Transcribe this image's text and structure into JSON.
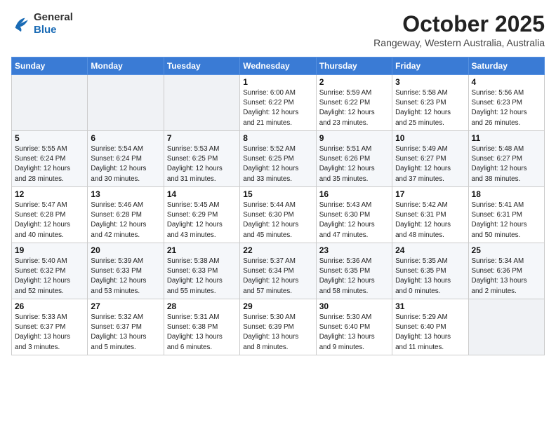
{
  "header": {
    "logo_line1": "General",
    "logo_line2": "Blue",
    "month_year": "October 2025",
    "location": "Rangeway, Western Australia, Australia"
  },
  "weekdays": [
    "Sunday",
    "Monday",
    "Tuesday",
    "Wednesday",
    "Thursday",
    "Friday",
    "Saturday"
  ],
  "weeks": [
    [
      {
        "day": "",
        "info": ""
      },
      {
        "day": "",
        "info": ""
      },
      {
        "day": "",
        "info": ""
      },
      {
        "day": "1",
        "info": "Sunrise: 6:00 AM\nSunset: 6:22 PM\nDaylight: 12 hours\nand 21 minutes."
      },
      {
        "day": "2",
        "info": "Sunrise: 5:59 AM\nSunset: 6:22 PM\nDaylight: 12 hours\nand 23 minutes."
      },
      {
        "day": "3",
        "info": "Sunrise: 5:58 AM\nSunset: 6:23 PM\nDaylight: 12 hours\nand 25 minutes."
      },
      {
        "day": "4",
        "info": "Sunrise: 5:56 AM\nSunset: 6:23 PM\nDaylight: 12 hours\nand 26 minutes."
      }
    ],
    [
      {
        "day": "5",
        "info": "Sunrise: 5:55 AM\nSunset: 6:24 PM\nDaylight: 12 hours\nand 28 minutes."
      },
      {
        "day": "6",
        "info": "Sunrise: 5:54 AM\nSunset: 6:24 PM\nDaylight: 12 hours\nand 30 minutes."
      },
      {
        "day": "7",
        "info": "Sunrise: 5:53 AM\nSunset: 6:25 PM\nDaylight: 12 hours\nand 31 minutes."
      },
      {
        "day": "8",
        "info": "Sunrise: 5:52 AM\nSunset: 6:25 PM\nDaylight: 12 hours\nand 33 minutes."
      },
      {
        "day": "9",
        "info": "Sunrise: 5:51 AM\nSunset: 6:26 PM\nDaylight: 12 hours\nand 35 minutes."
      },
      {
        "day": "10",
        "info": "Sunrise: 5:49 AM\nSunset: 6:27 PM\nDaylight: 12 hours\nand 37 minutes."
      },
      {
        "day": "11",
        "info": "Sunrise: 5:48 AM\nSunset: 6:27 PM\nDaylight: 12 hours\nand 38 minutes."
      }
    ],
    [
      {
        "day": "12",
        "info": "Sunrise: 5:47 AM\nSunset: 6:28 PM\nDaylight: 12 hours\nand 40 minutes."
      },
      {
        "day": "13",
        "info": "Sunrise: 5:46 AM\nSunset: 6:28 PM\nDaylight: 12 hours\nand 42 minutes."
      },
      {
        "day": "14",
        "info": "Sunrise: 5:45 AM\nSunset: 6:29 PM\nDaylight: 12 hours\nand 43 minutes."
      },
      {
        "day": "15",
        "info": "Sunrise: 5:44 AM\nSunset: 6:30 PM\nDaylight: 12 hours\nand 45 minutes."
      },
      {
        "day": "16",
        "info": "Sunrise: 5:43 AM\nSunset: 6:30 PM\nDaylight: 12 hours\nand 47 minutes."
      },
      {
        "day": "17",
        "info": "Sunrise: 5:42 AM\nSunset: 6:31 PM\nDaylight: 12 hours\nand 48 minutes."
      },
      {
        "day": "18",
        "info": "Sunrise: 5:41 AM\nSunset: 6:31 PM\nDaylight: 12 hours\nand 50 minutes."
      }
    ],
    [
      {
        "day": "19",
        "info": "Sunrise: 5:40 AM\nSunset: 6:32 PM\nDaylight: 12 hours\nand 52 minutes."
      },
      {
        "day": "20",
        "info": "Sunrise: 5:39 AM\nSunset: 6:33 PM\nDaylight: 12 hours\nand 53 minutes."
      },
      {
        "day": "21",
        "info": "Sunrise: 5:38 AM\nSunset: 6:33 PM\nDaylight: 12 hours\nand 55 minutes."
      },
      {
        "day": "22",
        "info": "Sunrise: 5:37 AM\nSunset: 6:34 PM\nDaylight: 12 hours\nand 57 minutes."
      },
      {
        "day": "23",
        "info": "Sunrise: 5:36 AM\nSunset: 6:35 PM\nDaylight: 12 hours\nand 58 minutes."
      },
      {
        "day": "24",
        "info": "Sunrise: 5:35 AM\nSunset: 6:35 PM\nDaylight: 13 hours\nand 0 minutes."
      },
      {
        "day": "25",
        "info": "Sunrise: 5:34 AM\nSunset: 6:36 PM\nDaylight: 13 hours\nand 2 minutes."
      }
    ],
    [
      {
        "day": "26",
        "info": "Sunrise: 5:33 AM\nSunset: 6:37 PM\nDaylight: 13 hours\nand 3 minutes."
      },
      {
        "day": "27",
        "info": "Sunrise: 5:32 AM\nSunset: 6:37 PM\nDaylight: 13 hours\nand 5 minutes."
      },
      {
        "day": "28",
        "info": "Sunrise: 5:31 AM\nSunset: 6:38 PM\nDaylight: 13 hours\nand 6 minutes."
      },
      {
        "day": "29",
        "info": "Sunrise: 5:30 AM\nSunset: 6:39 PM\nDaylight: 13 hours\nand 8 minutes."
      },
      {
        "day": "30",
        "info": "Sunrise: 5:30 AM\nSunset: 6:40 PM\nDaylight: 13 hours\nand 9 minutes."
      },
      {
        "day": "31",
        "info": "Sunrise: 5:29 AM\nSunset: 6:40 PM\nDaylight: 13 hours\nand 11 minutes."
      },
      {
        "day": "",
        "info": ""
      }
    ]
  ]
}
